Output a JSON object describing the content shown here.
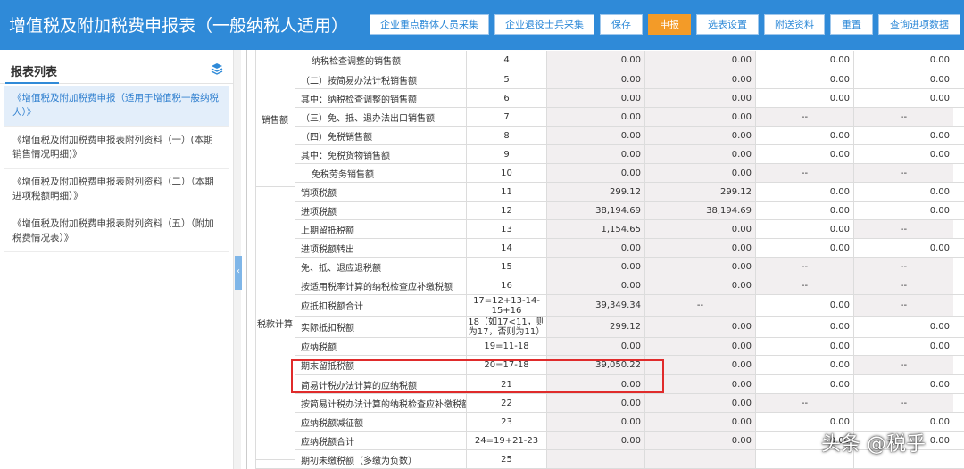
{
  "header": {
    "title": "增值税及附加税费申报表（一般纳税人适用）",
    "buttons": [
      {
        "label": "企业重点群体人员采集"
      },
      {
        "label": "企业退役士兵采集"
      },
      {
        "label": "保存"
      },
      {
        "label": "申报",
        "active": true
      },
      {
        "label": "选表设置"
      },
      {
        "label": "附送资料"
      },
      {
        "label": "重置"
      },
      {
        "label": "查询进项数据"
      }
    ]
  },
  "sidebar": {
    "title": "报表列表",
    "icon": "layers-icon",
    "items": [
      {
        "label": "《增值税及附加税费申报（适用于增值税一般纳税人）》",
        "active": true
      },
      {
        "label": "《增值税及附加税费申报表附列资料（一）(本期销售情况明细)》"
      },
      {
        "label": "《增值税及附加税费申报表附列资料（二）（本期进项税额明细）》"
      },
      {
        "label": "《增值税及附加税费申报表附列资料（五）（附加税费情况表）》"
      }
    ]
  },
  "table": {
    "groups": [
      {
        "label": "销售额"
      },
      {
        "label": "税款计算"
      }
    ],
    "rows": [
      {
        "name": "纳税检查调整的销售额",
        "num": "4",
        "v": [
          "0.00",
          "0.00",
          "0.00",
          "0.00"
        ]
      },
      {
        "name": "（二）按简易办法计税销售额",
        "num": "5",
        "v": [
          "0.00",
          "0.00",
          "0.00",
          "0.00"
        ]
      },
      {
        "name": "其中：纳税检查调整的销售额",
        "num": "6",
        "v": [
          "0.00",
          "0.00",
          "0.00",
          "0.00"
        ]
      },
      {
        "name": "（三）免、抵、退办法出口销售额",
        "num": "7",
        "v": [
          "0.00",
          "0.00",
          "--",
          "--"
        ]
      },
      {
        "name": "（四）免税销售额",
        "num": "8",
        "v": [
          "0.00",
          "0.00",
          "0.00",
          "0.00"
        ]
      },
      {
        "name": "其中：免税货物销售额",
        "num": "9",
        "v": [
          "0.00",
          "0.00",
          "0.00",
          "0.00"
        ]
      },
      {
        "name": "免税劳务销售额",
        "num": "10",
        "v": [
          "0.00",
          "0.00",
          "--",
          "--"
        ]
      },
      {
        "name": "销项税额",
        "num": "11",
        "v": [
          "299.12",
          "299.12",
          "0.00",
          "0.00"
        ]
      },
      {
        "name": "进项税额",
        "num": "12",
        "v": [
          "38,194.69",
          "38,194.69",
          "0.00",
          "0.00"
        ]
      },
      {
        "name": "上期留抵税额",
        "num": "13",
        "v": [
          "1,154.65",
          "0.00",
          "0.00",
          "--"
        ]
      },
      {
        "name": "进项税额转出",
        "num": "14",
        "v": [
          "0.00",
          "0.00",
          "0.00",
          "0.00"
        ]
      },
      {
        "name": "免、抵、退应退税额",
        "num": "15",
        "v": [
          "0.00",
          "0.00",
          "--",
          "--"
        ]
      },
      {
        "name": "按适用税率计算的纳税检查应补缴税额",
        "num": "16",
        "v": [
          "0.00",
          "0.00",
          "--",
          "--"
        ]
      },
      {
        "name": "应抵扣税额合计",
        "num": "17=12+13-14-15+16",
        "v": [
          "39,349.34",
          "--",
          "0.00",
          "--"
        ]
      },
      {
        "name": "实际抵扣税额",
        "num": "18（如17<11，则为17，否则为11）",
        "v": [
          "299.12",
          "0.00",
          "0.00",
          "0.00"
        ]
      },
      {
        "name": "应纳税额",
        "num": "19=11-18",
        "v": [
          "0.00",
          "0.00",
          "0.00",
          "0.00"
        ]
      },
      {
        "name": "期末留抵税额",
        "num": "20=17-18",
        "v": [
          "39,050.22",
          "0.00",
          "0.00",
          "--"
        ]
      },
      {
        "name": "简易计税办法计算的应纳税额",
        "num": "21",
        "v": [
          "0.00",
          "0.00",
          "0.00",
          "0.00"
        ]
      },
      {
        "name": "按简易计税办法计算的纳税检查应补缴税额",
        "num": "22",
        "v": [
          "0.00",
          "0.00",
          "--",
          "--"
        ]
      },
      {
        "name": "应纳税额减征额",
        "num": "23",
        "v": [
          "0.00",
          "0.00",
          "0.00",
          "0.00"
        ]
      },
      {
        "name": "应纳税额合计",
        "num": "24=19+21-23",
        "v": [
          "0.00",
          "0.00",
          "0.00",
          "0.00"
        ]
      },
      {
        "name": "期初未缴税额（多缴为负数）",
        "num": "25",
        "v": [
          "",
          "",
          "",
          ""
        ]
      }
    ]
  },
  "watermark": "头条 @税乎"
}
